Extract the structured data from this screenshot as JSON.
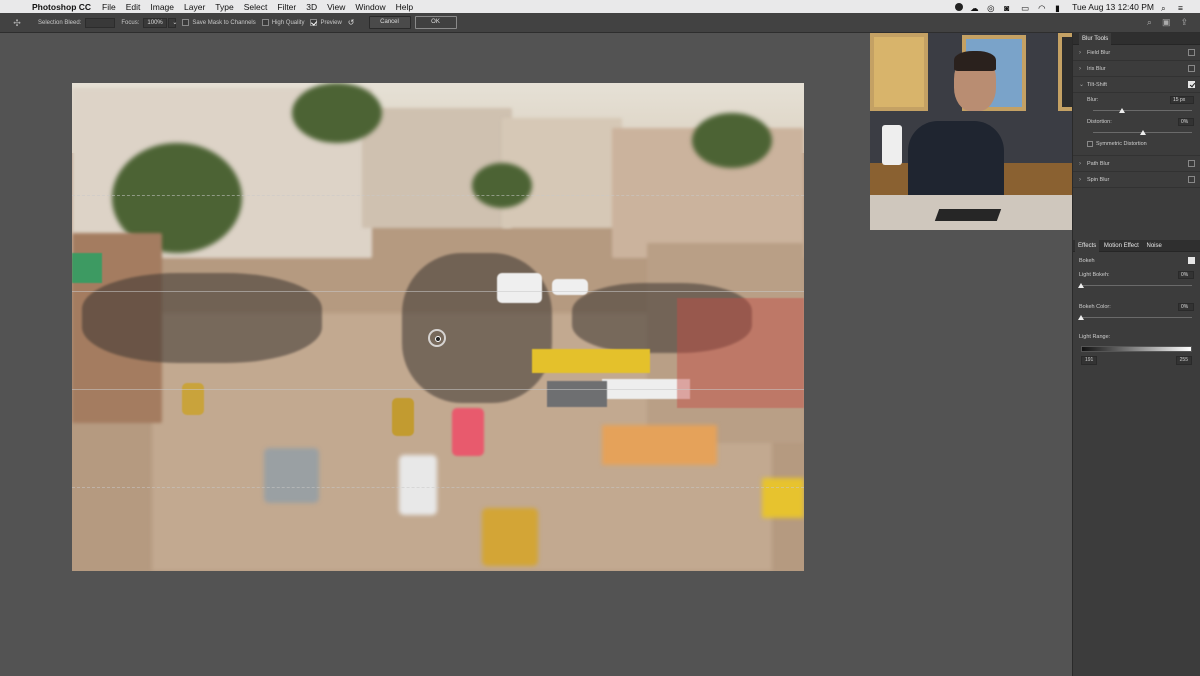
{
  "menubar": {
    "app": "Photoshop CC",
    "items": [
      "File",
      "Edit",
      "Image",
      "Layer",
      "Type",
      "Select",
      "Filter",
      "3D",
      "View",
      "Window",
      "Help"
    ],
    "datetime": "Tue Aug 13  12:40 PM"
  },
  "options_bar": {
    "selection_bleed_label": "Selection Bleed:",
    "selection_bleed_value": "",
    "focus_label": "Focus:",
    "focus_value": "100%",
    "save_mask_label": "Save Mask to Channels",
    "save_mask_checked": false,
    "high_quality_label": "High Quality",
    "high_quality_checked": false,
    "preview_label": "Preview",
    "preview_checked": true,
    "cancel_label": "Cancel",
    "ok_label": "OK"
  },
  "blur_tools": {
    "title": "Blur Tools",
    "items": [
      {
        "label": "Field Blur",
        "checked": false,
        "expanded": false
      },
      {
        "label": "Iris Blur",
        "checked": false,
        "expanded": false
      },
      {
        "label": "Tilt-Shift",
        "checked": true,
        "expanded": true
      },
      {
        "label": "Path Blur",
        "checked": false,
        "expanded": false
      },
      {
        "label": "Spin Blur",
        "checked": false,
        "expanded": false
      }
    ],
    "tilt_shift": {
      "blur_label": "Blur:",
      "blur_value": "15 px",
      "blur_level": 0.29,
      "distortion_label": "Distortion:",
      "distortion_value": "0%",
      "distortion_level": 0.5,
      "symmetric_label": "Symmetric Distortion",
      "symmetric_checked": false
    }
  },
  "effects": {
    "tabs": [
      "Effects",
      "Motion Effect",
      "Noise"
    ],
    "bokeh_label": "Bokeh",
    "bokeh_checked": true,
    "light_bokeh_label": "Light Bokeh:",
    "light_bokeh_value": "0%",
    "light_bokeh_level": 0,
    "bokeh_color_label": "Bokeh Color:",
    "bokeh_color_value": "0%",
    "bokeh_color_level": 0,
    "light_range_label": "Light Range:",
    "light_range_min": "191",
    "light_range_max": "255"
  },
  "colors": {
    "app_bg": "#535353",
    "panel_bg": "#3c3c3c",
    "menubar_bg": "#e9e9ea"
  }
}
